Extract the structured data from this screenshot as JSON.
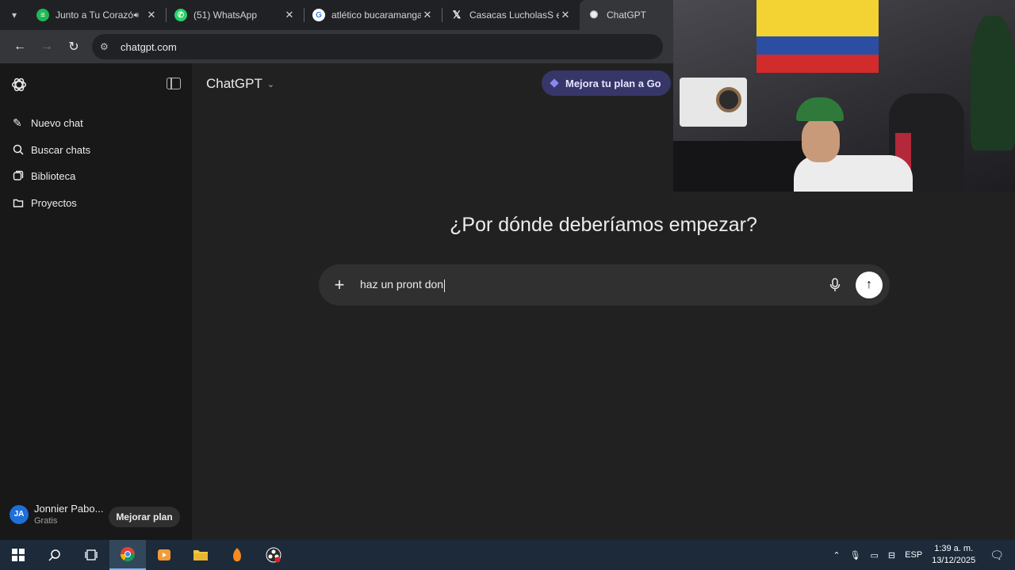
{
  "browser": {
    "tabs": [
      {
        "title": "Junto a Tu Corazón",
        "favicon": "spotify-icon",
        "color": "#1db954",
        "audio": true,
        "active": false
      },
      {
        "title": "(51) WhatsApp",
        "favicon": "whatsapp-icon",
        "color": "#25d366",
        "audio": false,
        "active": false
      },
      {
        "title": "atlético bucaramanga",
        "favicon": "google-icon",
        "color": "#4285f4",
        "audio": false,
        "active": false
      },
      {
        "title": "Casacas LucholasS en",
        "favicon": "x-icon",
        "color": "#000000",
        "audio": false,
        "active": false
      },
      {
        "title": "ChatGPT",
        "favicon": "chatgpt-icon",
        "color": "#ececec",
        "audio": false,
        "active": true
      }
    ],
    "url": "chatgpt.com"
  },
  "sidebar": {
    "items": [
      {
        "label": "Nuevo chat",
        "icon": "edit-icon"
      },
      {
        "label": "Buscar chats",
        "icon": "search-icon"
      },
      {
        "label": "Biblioteca",
        "icon": "library-icon"
      },
      {
        "label": "Proyectos",
        "icon": "folder-icon"
      }
    ],
    "user": {
      "initials": "JA",
      "name": "Jonnier Pabo...",
      "plan": "Gratis"
    },
    "upgrade_label": "Mejorar plan"
  },
  "main": {
    "model": "ChatGPT",
    "go_button": "Mejora tu plan a Go",
    "headline": "¿Por dónde deberíamos empezar?",
    "prompt_text": "haz un pront don"
  },
  "taskbar": {
    "language": "ESP",
    "time": "1:39 a. m.",
    "date": "13/12/2025"
  },
  "colors": {
    "accent_go": "#373669",
    "avatar": "#1e6fd9"
  }
}
